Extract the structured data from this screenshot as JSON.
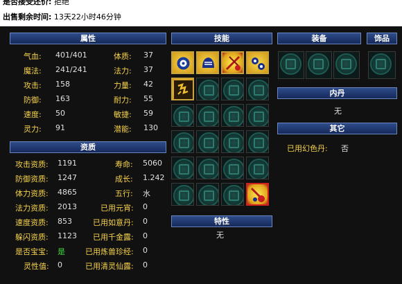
{
  "top": {
    "accept_label": "是否接受还价:",
    "accept_value": "拒绝",
    "remain_label": "出售剩余时间:",
    "remain_value": "13天22小时46分钟"
  },
  "attributes": {
    "title": "属性",
    "rows": [
      {
        "l1": "气血:",
        "v1": "401/401",
        "l2": "体质:",
        "v2": "37"
      },
      {
        "l1": "魔法:",
        "v1": "241/241",
        "l2": "法力:",
        "v2": "37"
      },
      {
        "l1": "攻击:",
        "v1": "158",
        "l2": "力量:",
        "v2": "42"
      },
      {
        "l1": "防御:",
        "v1": "163",
        "l2": "耐力:",
        "v2": "55"
      },
      {
        "l1": "速度:",
        "v1": "50",
        "l2": "敏捷:",
        "v2": "59"
      },
      {
        "l1": "灵力:",
        "v1": "91",
        "l2": "潜能:",
        "v2": "130"
      }
    ]
  },
  "quality": {
    "title": "资质",
    "rows": [
      {
        "l1": "攻击资质:",
        "v1": "1191",
        "l2": "寿命:",
        "v2": "5060"
      },
      {
        "l1": "防御资质:",
        "v1": "1247",
        "l2": "成长:",
        "v2": "1.242"
      },
      {
        "l1": "体力资质:",
        "v1": "4865",
        "l2": "五行:",
        "v2": "水"
      },
      {
        "l1": "法力资质:",
        "v1": "2013",
        "l2": "已用元宵:",
        "v2": "0"
      },
      {
        "l1": "速度资质:",
        "v1": "853",
        "l2": "已用如意丹:",
        "v2": "0"
      },
      {
        "l1": "躲闪资质:",
        "v1": "1123",
        "l2": "已用千金露:",
        "v2": "0"
      },
      {
        "l1": "是否宝宝:",
        "v1": "是",
        "l2": "已用炼兽珍经:",
        "v2": "0"
      },
      {
        "l1": "灵性值:",
        "v1": "0",
        "l2": "已用清灵仙露:",
        "v2": "0"
      }
    ]
  },
  "skills": {
    "title": "技能"
  },
  "traits": {
    "title": "特性",
    "value": "无"
  },
  "equipment": {
    "title": "装备"
  },
  "accessory": {
    "title": "饰品"
  },
  "inner_dan": {
    "title": "内丹",
    "value": "无"
  },
  "other": {
    "title": "其它",
    "label": "已用幻色丹:",
    "value": "否"
  },
  "colors": {
    "label_yellow": "#f6d24a",
    "value_green": "#3ddc3d",
    "header_blue": "#2e4c8a"
  }
}
